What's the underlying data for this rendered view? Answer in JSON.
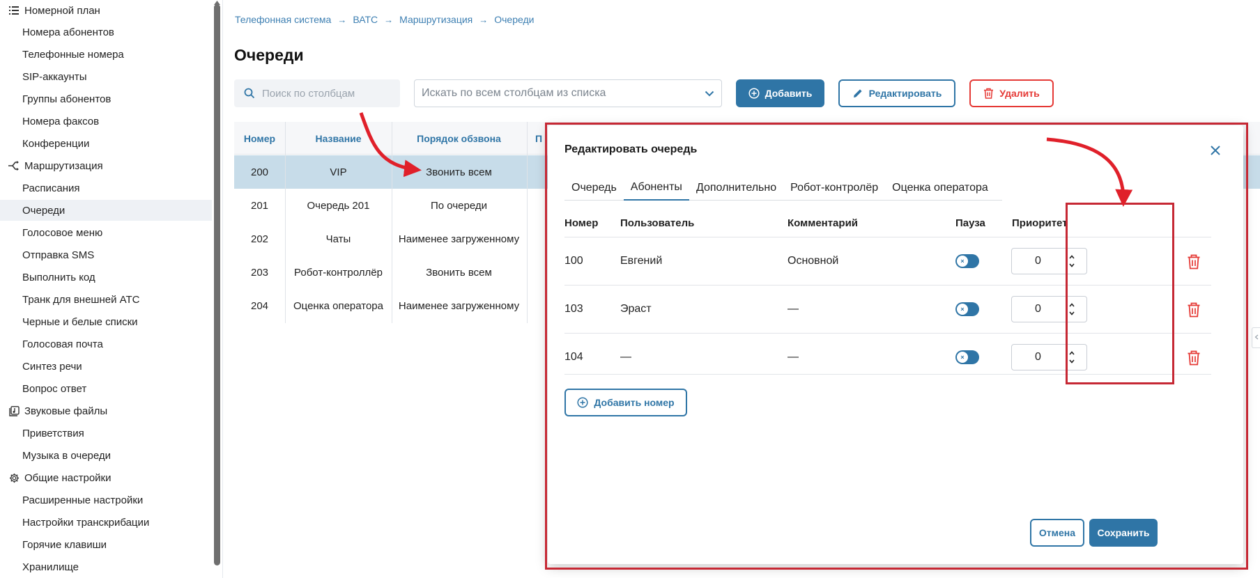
{
  "sidebar": {
    "items": [
      {
        "label": "Номерной план",
        "kind": "group",
        "icon": "list-icon"
      },
      {
        "label": "Номера абонентов",
        "kind": "sub"
      },
      {
        "label": "Телефонные номера",
        "kind": "sub"
      },
      {
        "label": "SIP-аккаунты",
        "kind": "sub"
      },
      {
        "label": "Группы абонентов",
        "kind": "sub"
      },
      {
        "label": "Номера факсов",
        "kind": "sub"
      },
      {
        "label": "Конференции",
        "kind": "sub"
      },
      {
        "label": "Маршрутизация",
        "kind": "group",
        "icon": "routing-icon"
      },
      {
        "label": "Расписания",
        "kind": "sub"
      },
      {
        "label": "Очереди",
        "kind": "sub",
        "active": true
      },
      {
        "label": "Голосовое меню",
        "kind": "sub"
      },
      {
        "label": "Отправка SMS",
        "kind": "sub"
      },
      {
        "label": "Выполнить код",
        "kind": "sub"
      },
      {
        "label": "Транк для внешней АТС",
        "kind": "sub"
      },
      {
        "label": "Черные и белые списки",
        "kind": "sub"
      },
      {
        "label": "Голосовая почта",
        "kind": "sub"
      },
      {
        "label": "Синтез речи",
        "kind": "sub"
      },
      {
        "label": "Вопрос ответ",
        "kind": "sub"
      },
      {
        "label": "Звуковые файлы",
        "kind": "group",
        "icon": "sound-files-icon"
      },
      {
        "label": "Приветствия",
        "kind": "sub"
      },
      {
        "label": "Музыка в очереди",
        "kind": "sub"
      },
      {
        "label": "Общие настройки",
        "kind": "group",
        "icon": "gear-icon"
      },
      {
        "label": "Расширенные настройки",
        "kind": "sub"
      },
      {
        "label": "Настройки транскрибации",
        "kind": "sub"
      },
      {
        "label": "Горячие клавиши",
        "kind": "sub"
      },
      {
        "label": "Хранилище",
        "kind": "sub"
      }
    ]
  },
  "breadcrumb": [
    "Телефонная система",
    "ВАТС",
    "Маршрутизация",
    "Очереди"
  ],
  "breadcrumb_sep": "→",
  "page_title": "Очереди",
  "search": {
    "placeholder": "Поиск по столбцам"
  },
  "column_filter": {
    "value": "Искать по всем столбцам из списка"
  },
  "toolbar": {
    "add_label": "Добавить",
    "edit_label": "Редактировать",
    "delete_label": "Удалить"
  },
  "grid": {
    "columns": [
      "Номер",
      "Название",
      "Порядок обзвона",
      "П"
    ],
    "rows": [
      {
        "number": "200",
        "name": "VIP",
        "order": "Звонить всем",
        "selected": true
      },
      {
        "number": "201",
        "name": "Очередь 201",
        "order": "По очереди"
      },
      {
        "number": "202",
        "name": "Чаты",
        "order": "Наименее загруженному"
      },
      {
        "number": "203",
        "name": "Робот-контроллёр",
        "order": "Звонить всем"
      },
      {
        "number": "204",
        "name": "Оценка оператора",
        "order": "Наименее загруженному"
      }
    ]
  },
  "modal": {
    "title": "Редактировать очередь",
    "tabs": [
      "Очередь",
      "Абоненты",
      "Дополнительно",
      "Робот-контролёр",
      "Оценка оператора"
    ],
    "active_tab": "Абоненты",
    "columns": {
      "number": "Номер",
      "user": "Пользователь",
      "comment": "Комментарий",
      "pause": "Пауза",
      "priority": "Приоритет"
    },
    "rows": [
      {
        "number": "100",
        "user": "Евгений",
        "comment": "Основной",
        "pause": true,
        "priority": "0"
      },
      {
        "number": "103",
        "user": "Эраст",
        "comment": "—",
        "pause": true,
        "priority": "0"
      },
      {
        "number": "104",
        "user": "—",
        "comment": "—",
        "pause": true,
        "priority": "0"
      }
    ],
    "add_number_label": "Добавить номер",
    "cancel_label": "Отмена",
    "save_label": "Сохранить"
  },
  "colors": {
    "accent": "#2f75a6",
    "danger": "#e53935",
    "annotation": "#c62834",
    "selected_row": "#c7dce9"
  }
}
